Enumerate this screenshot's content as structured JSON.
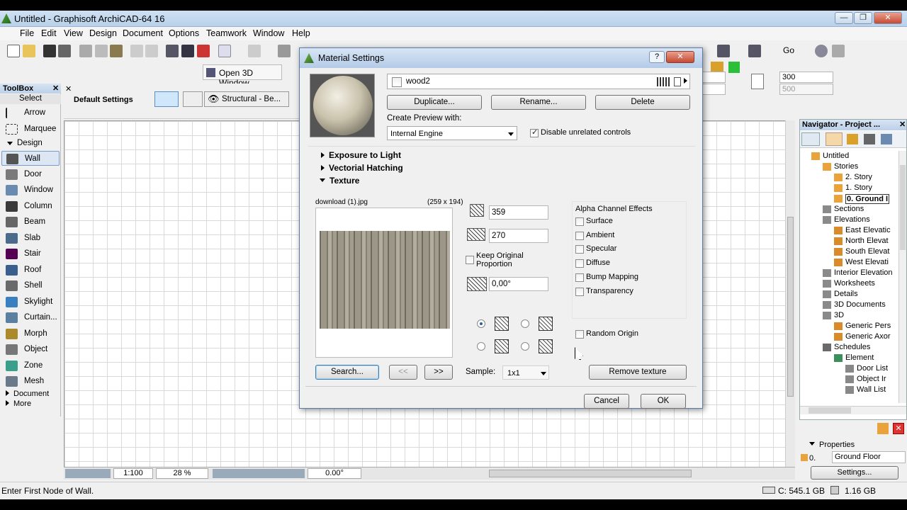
{
  "window": {
    "title": "Untitled - Graphisoft ArchiCAD-64 16",
    "min": "—",
    "max": "❐",
    "close": "✕"
  },
  "menu": [
    "File",
    "Edit",
    "View",
    "Design",
    "Document",
    "Options",
    "Teamwork",
    "Window",
    "Help"
  ],
  "toolbar": {
    "open_3d_window": "Open 3D Window",
    "go_label": "Go",
    "field_300": "300",
    "field_500": "500"
  },
  "toolbox": {
    "title": "ToolBox",
    "close": "✕",
    "select": "Select",
    "arrow": "Arrow",
    "marquee": "Marquee",
    "design_section": "Design",
    "items": [
      "Wall",
      "Door",
      "Window",
      "Column",
      "Beam",
      "Slab",
      "Stair",
      "Roof",
      "Shell",
      "Skylight",
      "Curtain...",
      "Morph",
      "Object",
      "Zone",
      "Mesh"
    ],
    "document": "Document",
    "more": "More"
  },
  "infobox": {
    "close": "✕",
    "default_settings": "Default Settings",
    "structural": "Structural - Be..."
  },
  "dialog": {
    "title": "Material Settings",
    "help": "?",
    "close": "✕",
    "material_name": "wood2",
    "duplicate": "Duplicate...",
    "rename": "Rename...",
    "delete": "Delete",
    "create_preview_label": "Create Preview with:",
    "preview_engine": "Internal Engine",
    "disable_unrelated": "Disable unrelated controls",
    "disable_unrelated_checked": true,
    "sections": {
      "exposure": "Exposure to Light",
      "hatching": "Vectorial Hatching",
      "texture": "Texture"
    },
    "texture": {
      "file_name": "download (1).jpg",
      "dimensions": "(259 x 194)",
      "width": "359",
      "height": "270",
      "keep_proportion": "Keep Original Proportion",
      "angle": "0,00°",
      "search": "Search...",
      "prev": "<<",
      "next": ">>",
      "sample_label": "Sample:",
      "sample_value": "1x1",
      "remove": "Remove texture",
      "alpha_title": "Alpha Channel Effects",
      "alpha_effects": [
        "Surface",
        "Ambient",
        "Specular",
        "Diffuse",
        "Bump Mapping",
        "Transparency"
      ],
      "random_origin": "Random Origin"
    },
    "cancel": "Cancel",
    "ok": "OK"
  },
  "navigator": {
    "title": "Navigator - Project ...",
    "close": "✕",
    "tree": [
      {
        "label": "Untitled",
        "level": 0
      },
      {
        "label": "Stories",
        "level": 1
      },
      {
        "label": "2. Story",
        "level": 2
      },
      {
        "label": "1. Story",
        "level": 2
      },
      {
        "label": "0. Ground I",
        "level": 2,
        "selected": true
      },
      {
        "label": "Sections",
        "level": 1
      },
      {
        "label": "Elevations",
        "level": 1
      },
      {
        "label": "East Elevatic",
        "level": 2
      },
      {
        "label": "North Elevat",
        "level": 2
      },
      {
        "label": "South Elevat",
        "level": 2
      },
      {
        "label": "West Elevati",
        "level": 2
      },
      {
        "label": "Interior Elevation",
        "level": 1
      },
      {
        "label": "Worksheets",
        "level": 1
      },
      {
        "label": "Details",
        "level": 1
      },
      {
        "label": "3D Documents",
        "level": 1
      },
      {
        "label": "3D",
        "level": 1
      },
      {
        "label": "Generic Pers",
        "level": 2
      },
      {
        "label": "Generic Axor",
        "level": 2
      },
      {
        "label": "Schedules",
        "level": 1
      },
      {
        "label": "Element",
        "level": 2
      },
      {
        "label": "Door List",
        "level": 3
      },
      {
        "label": "Object Ir",
        "level": 3
      },
      {
        "label": "Wall List",
        "level": 3
      }
    ],
    "properties": "Properties",
    "prop_id": "0.",
    "prop_name": "Ground Floor",
    "settings": "Settings..."
  },
  "bottombar": {
    "scale": "1:100",
    "zoom": "28 %",
    "angle": "0.00°"
  },
  "status": {
    "message": "Enter First Node of Wall.",
    "disk": "C: 545.1 GB",
    "ram": "1.16 GB"
  }
}
